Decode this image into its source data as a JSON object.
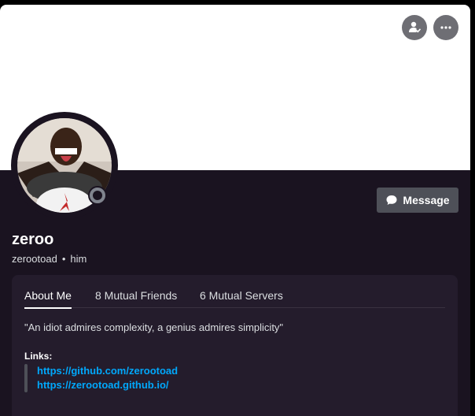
{
  "header": {
    "icons": [
      "friend-request-icon",
      "more-icon"
    ]
  },
  "profile": {
    "display_name": "zeroo",
    "username": "zerootoad",
    "separator": "•",
    "pronouns": "him",
    "status": "offline"
  },
  "actions": {
    "message_label": "Message"
  },
  "tabs": [
    {
      "label": "About Me"
    },
    {
      "label": "8 Mutual Friends"
    },
    {
      "label": "6 Mutual Servers"
    }
  ],
  "about": {
    "bio": "\"An idiot admires complexity, a genius admires simplicity\"",
    "links_label": "Links:",
    "links": [
      "https://github.com/zerootoad",
      "https://zerootoad.github.io/"
    ]
  },
  "colors": {
    "accent_link": "#00a8fc",
    "panel_bg": "#1a1320",
    "inner_bg": "#241c2c",
    "button_bg": "#4e5058"
  }
}
